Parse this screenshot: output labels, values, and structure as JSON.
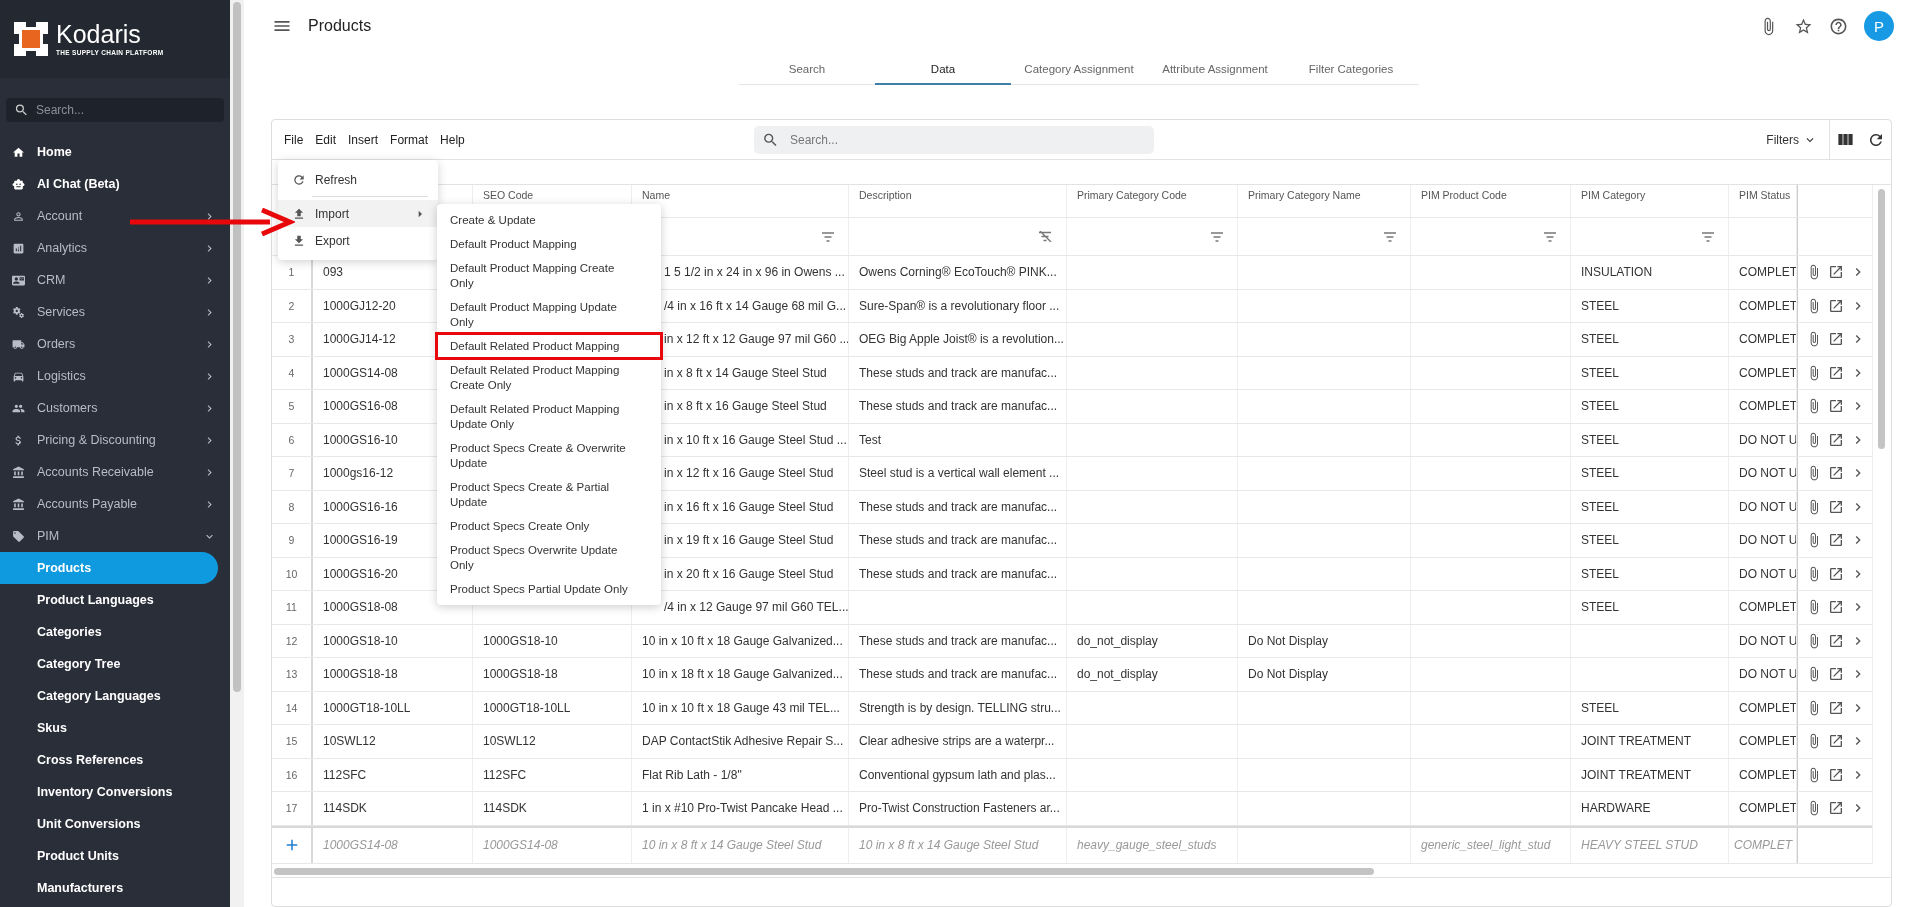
{
  "logo": {
    "name": "Kodaris",
    "tagline": "THE SUPPLY CHAIN PLATFORM"
  },
  "sidebar": {
    "search": {
      "placeholder": "Search..."
    },
    "items": [
      {
        "label": "Home"
      },
      {
        "label": "AI Chat (Beta)"
      },
      {
        "label": "Account",
        "expanded": false
      },
      {
        "label": "Analytics",
        "expanded": false
      },
      {
        "label": "CRM",
        "expanded": false
      },
      {
        "label": "Services",
        "expanded": false
      },
      {
        "label": "Orders",
        "expanded": false
      },
      {
        "label": "Logistics",
        "expanded": false
      },
      {
        "label": "Customers",
        "expanded": false
      },
      {
        "label": "Pricing & Discounting",
        "expanded": false
      },
      {
        "label": "Accounts Receivable",
        "expanded": false
      },
      {
        "label": "Accounts Payable",
        "expanded": false
      },
      {
        "label": "PIM",
        "expanded": true,
        "children": [
          {
            "label": "Products",
            "selected": true
          },
          {
            "label": "Product Languages",
            "selected": false
          },
          {
            "label": "Categories",
            "selected": false
          },
          {
            "label": "Category Tree",
            "selected": false
          },
          {
            "label": "Category Languages",
            "selected": false
          },
          {
            "label": "Skus",
            "selected": false
          },
          {
            "label": "Cross References",
            "selected": false
          },
          {
            "label": "Inventory Conversions",
            "selected": false
          },
          {
            "label": "Unit Conversions",
            "selected": false
          },
          {
            "label": "Product Units",
            "selected": false
          },
          {
            "label": "Manufacturers",
            "selected": false
          }
        ]
      }
    ]
  },
  "header": {
    "title": "Products",
    "avatar": "P"
  },
  "tabs": [
    {
      "label": "Search",
      "selected": false
    },
    {
      "label": "Data",
      "selected": true
    },
    {
      "label": "Category Assignment",
      "selected": false
    },
    {
      "label": "Attribute Assignment",
      "selected": false
    },
    {
      "label": "Filter Categories",
      "selected": false
    }
  ],
  "toolbar": {
    "menus": [
      "File",
      "Edit",
      "Insert",
      "Format",
      "Help"
    ],
    "search": {
      "placeholder": "Search..."
    },
    "filters": "Filters"
  },
  "file_menu": {
    "items": [
      {
        "label": "Refresh",
        "active": false
      },
      {
        "label": "Import",
        "active": true,
        "pointed": true,
        "submenu": [
          {
            "label": "Create & Update",
            "highlighted": false
          },
          {
            "label": "Default Product Mapping",
            "highlighted": false
          },
          {
            "label": "Default Product Mapping Create Only",
            "highlighted": false
          },
          {
            "label": "Default Product Mapping Update Only",
            "highlighted": false
          },
          {
            "label": "Default Related Product Mapping",
            "highlighted": true
          },
          {
            "label": "Default Related Product Mapping Create Only",
            "highlighted": false
          },
          {
            "label": "Default Related Product Mapping Update Only",
            "highlighted": false
          },
          {
            "label": "Product Specs Create & Overwrite Update",
            "highlighted": false
          },
          {
            "label": "Product Specs Create & Partial Update",
            "highlighted": false
          },
          {
            "label": "Product Specs Create Only",
            "highlighted": false
          },
          {
            "label": "Product Specs Overwrite Update Only",
            "highlighted": false
          },
          {
            "label": "Product Specs Partial Update Only",
            "highlighted": false
          }
        ]
      },
      {
        "label": "Export",
        "active": false
      }
    ]
  },
  "table": {
    "columns": [
      {
        "kind": "hidden"
      },
      {
        "label": "SEO Code",
        "kind": "plain"
      },
      {
        "label": "Name",
        "kind": "filter"
      },
      {
        "label": "Description",
        "kind": "filter-off"
      },
      {
        "label": "Primary Category Code",
        "kind": "filter"
      },
      {
        "label": "Primary Category Name",
        "kind": "filter"
      },
      {
        "label": "PIM Product Code",
        "kind": "filter"
      },
      {
        "label": "PIM Category",
        "kind": "filter"
      },
      {
        "label": "PIM Status",
        "kind": "plain"
      }
    ],
    "rows": [
      {
        "number": "1",
        "cells": [
          "093",
          null,
          "1 5 1/2 in x 24 in x 96 in Owens ...",
          "Owens Corning® EcoTouch® PINK...",
          null,
          null,
          null,
          "INSULATION",
          "COMPLET"
        ]
      },
      {
        "number": "2",
        "cells": [
          "1000GJ12-20",
          null,
          "/4 in x 16 ft x 14 Gauge 68 mil G...",
          "Sure-Span® is a revolutionary floor ...",
          null,
          null,
          null,
          "STEEL",
          "COMPLET"
        ]
      },
      {
        "number": "3",
        "cells": [
          "1000GJ14-12",
          null,
          "in x 12 ft x 12 Gauge 97 mil G60 ...",
          "OEG Big Apple Joist® is a revolution...",
          null,
          null,
          null,
          "STEEL",
          "COMPLET"
        ]
      },
      {
        "number": "4",
        "cells": [
          "1000GS14-08",
          null,
          "in x 8 ft x 14 Gauge Steel Stud",
          "These studs and track are manufac...",
          null,
          null,
          null,
          "STEEL",
          "COMPLET"
        ]
      },
      {
        "number": "5",
        "cells": [
          "1000GS16-08",
          null,
          "in x 8 ft x 16 Gauge Steel Stud",
          "These studs and track are manufac...",
          null,
          null,
          null,
          "STEEL",
          "COMPLET"
        ]
      },
      {
        "number": "6",
        "cells": [
          "1000GS16-10",
          null,
          "in x 10 ft x 16 Gauge Steel Stud ...",
          "Test",
          null,
          null,
          null,
          "STEEL",
          "DO NOT U"
        ]
      },
      {
        "number": "7",
        "cells": [
          "1000gs16-12",
          null,
          "in x 12 ft x 16 Gauge Steel Stud",
          "Steel stud is a vertical wall element ...",
          null,
          null,
          null,
          "STEEL",
          "DO NOT U"
        ]
      },
      {
        "number": "8",
        "cells": [
          "1000GS16-16",
          null,
          "in x 16 ft x 16 Gauge Steel Stud",
          "These studs and track are manufac...",
          null,
          null,
          null,
          "STEEL",
          "DO NOT U"
        ]
      },
      {
        "number": "9",
        "cells": [
          "1000GS16-19",
          null,
          "in x 19 ft x 16 Gauge Steel Stud",
          "These studs and track are manufac...",
          null,
          null,
          null,
          "STEEL",
          "DO NOT U"
        ]
      },
      {
        "number": "10",
        "cells": [
          "1000GS16-20",
          null,
          "in x 20 ft x 16 Gauge Steel Stud",
          "These studs and track are manufac...",
          null,
          null,
          null,
          "STEEL",
          "DO NOT U"
        ]
      },
      {
        "number": "11",
        "cells": [
          "1000GS18-08",
          null,
          "/4 in x 12 Gauge 97 mil G60 TEL...",
          null,
          null,
          null,
          null,
          "STEEL",
          "COMPLET"
        ]
      },
      {
        "number": "12",
        "cells": [
          "1000GS18-10",
          "1000GS18-10",
          "10 in x 10 ft x 18 Gauge Galvanized...",
          "These studs and track are manufac...",
          "do_not_display",
          "Do Not Display",
          null,
          null,
          "DO NOT U"
        ]
      },
      {
        "number": "13",
        "cells": [
          "1000GS18-18",
          "1000GS18-18",
          "10 in x 18 ft x 18 Gauge Galvanized...",
          "These studs and track are manufac...",
          "do_not_display",
          "Do Not Display",
          null,
          null,
          "DO NOT U"
        ]
      },
      {
        "number": "14",
        "cells": [
          "1000GT18-10LL",
          "1000GT18-10LL",
          "10 in x 10 ft x 18 Gauge 43 mil TEL...",
          "Strength is by design. TELLING stru...",
          null,
          null,
          null,
          "STEEL",
          "COMPLET"
        ]
      },
      {
        "number": "15",
        "cells": [
          "10SWL12",
          "10SWL12",
          "DAP ContactStik Adhesive Repair S...",
          "Clear adhesive strips are a waterpr...",
          null,
          null,
          null,
          "JOINT TREATMENT",
          "COMPLET"
        ]
      },
      {
        "number": "16",
        "cells": [
          "112SFC",
          "112SFC",
          "Flat Rib Lath - 1/8\"",
          "Conventional gypsum lath and plas...",
          null,
          null,
          null,
          "JOINT TREATMENT",
          "COMPLET"
        ]
      },
      {
        "number": "17",
        "cells": [
          "114SDK",
          "114SDK",
          "1 in x #10 Pro-Twist Pancake Head ...",
          "Pro-Twist Construction Fasteners ar...",
          null,
          null,
          null,
          "HARDWARE",
          "COMPLET"
        ]
      }
    ],
    "new_row": {
      "cells": [
        "1000GS14-08",
        "1000GS14-08",
        "10 in x 8 ft x 14 Gauge Steel Stud",
        "10 in x 8 ft x 14 Gauge Steel Stud",
        "heavy_gauge_steel_studs",
        null,
        "generic_steel_light_stud",
        "HEAVY STEEL STUD",
        "COMPLET"
      ]
    }
  }
}
